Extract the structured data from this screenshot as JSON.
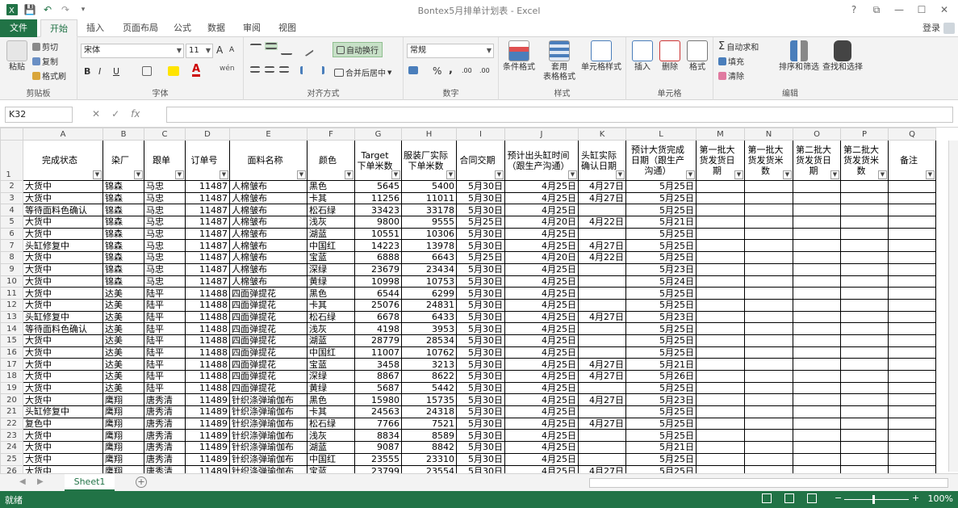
{
  "window": {
    "title": "Bontex5月排单计划表 - Excel"
  },
  "qat": {
    "save": "💾",
    "undo": "↶",
    "redo": "↷",
    "more": "▾"
  },
  "winctl": {
    "help": "?",
    "restore": "⧉",
    "min": "—",
    "max": "☐",
    "close": "✕"
  },
  "tabs": [
    "文件",
    "开始",
    "插入",
    "页面布局",
    "公式",
    "数据",
    "审阅",
    "视图"
  ],
  "active_tab": "开始",
  "account": {
    "login": "登录"
  },
  "ribbon": {
    "clipboard": {
      "paste": "粘贴",
      "cut": "剪切",
      "copy": "复制",
      "painter": "格式刷",
      "label": "剪贴板"
    },
    "font": {
      "name": "宋体",
      "size": "11",
      "bold": "B",
      "italic": "I",
      "underline": "U",
      "grow": "A",
      "shrink": "A",
      "label": "字体",
      "wen": "wén"
    },
    "align": {
      "wrap": "自动换行",
      "merge": "合并后居中",
      "label": "对齐方式"
    },
    "number": {
      "format": "常规",
      "percent": "%",
      "comma": ",",
      "inc": ".00",
      "label": "数字"
    },
    "styles": {
      "cond": "条件格式",
      "table": "套用\n表格格式",
      "cell": "单元格样式",
      "label": "样式"
    },
    "cells": {
      "insert": "插入",
      "delete": "删除",
      "format": "格式",
      "label": "单元格"
    },
    "editing": {
      "autosum": "自动求和",
      "fill": "填充",
      "clear": "清除",
      "sort": "排序和筛选",
      "find": "查找和选择",
      "label": "编辑"
    }
  },
  "formula_bar": {
    "name_box": "K32",
    "cancel": "✕",
    "enter": "✓",
    "fx": "fx",
    "value": ""
  },
  "columns": [
    "A",
    "B",
    "C",
    "D",
    "E",
    "F",
    "G",
    "H",
    "I",
    "J",
    "K",
    "L",
    "M",
    "N",
    "O",
    "P",
    "Q"
  ],
  "headers": [
    "完成状态",
    "染厂",
    "跟单",
    "订单号",
    "面料名称",
    "颜色",
    "Target下单米数",
    "服装厂实际下单米数",
    "合同交期",
    "预计出头缸时间（跟生产沟通）",
    "头缸实际确认日期",
    "预计大货完成日期（跟生产沟通）",
    "第一批大货发货日期",
    "第一批大货发货米数",
    "第二批大货发货日期",
    "第二批大货发货米数",
    "备注"
  ],
  "rows": [
    [
      "大货中",
      "锦森",
      "马忠",
      "11487",
      "人棉皱布",
      "黑色",
      "5645",
      "5400",
      "5月30日",
      "4月25日",
      "4月27日",
      "5月25日"
    ],
    [
      "大货中",
      "锦森",
      "马忠",
      "11487",
      "人棉皱布",
      "卡其",
      "11256",
      "11011",
      "5月30日",
      "4月25日",
      "4月27日",
      "5月25日"
    ],
    [
      "等待面料色确认",
      "锦森",
      "马忠",
      "11487",
      "人棉皱布",
      "松石绿",
      "33423",
      "33178",
      "5月30日",
      "4月25日",
      "",
      "5月25日"
    ],
    [
      "大货中",
      "锦森",
      "马忠",
      "11487",
      "人棉皱布",
      "浅灰",
      "9800",
      "9555",
      "5月25日",
      "4月20日",
      "4月22日",
      "5月21日"
    ],
    [
      "大货中",
      "锦森",
      "马忠",
      "11487",
      "人棉皱布",
      "湖蓝",
      "10551",
      "10306",
      "5月30日",
      "4月25日",
      "",
      "5月25日"
    ],
    [
      "头缸修复中",
      "锦森",
      "马忠",
      "11487",
      "人棉皱布",
      "中国红",
      "14223",
      "13978",
      "5月30日",
      "4月25日",
      "4月27日",
      "5月25日"
    ],
    [
      "大货中",
      "锦森",
      "马忠",
      "11487",
      "人棉皱布",
      "宝蓝",
      "6888",
      "6643",
      "5月25日",
      "4月20日",
      "4月22日",
      "5月25日"
    ],
    [
      "大货中",
      "锦森",
      "马忠",
      "11487",
      "人棉皱布",
      "深绿",
      "23679",
      "23434",
      "5月30日",
      "4月25日",
      "",
      "5月23日"
    ],
    [
      "大货中",
      "锦森",
      "马忠",
      "11487",
      "人棉皱布",
      "黄绿",
      "10998",
      "10753",
      "5月30日",
      "4月25日",
      "",
      "5月24日"
    ],
    [
      "大货中",
      "达美",
      "陆平",
      "11488",
      "四面弹提花",
      "黑色",
      "6544",
      "6299",
      "5月30日",
      "4月25日",
      "",
      "5月25日"
    ],
    [
      "大货中",
      "达美",
      "陆平",
      "11488",
      "四面弹提花",
      "卡其",
      "25076",
      "24831",
      "5月30日",
      "4月25日",
      "",
      "5月25日"
    ],
    [
      "头缸修复中",
      "达美",
      "陆平",
      "11488",
      "四面弹提花",
      "松石绿",
      "6678",
      "6433",
      "5月30日",
      "4月25日",
      "4月27日",
      "5月23日"
    ],
    [
      "等待面料色确认",
      "达美",
      "陆平",
      "11488",
      "四面弹提花",
      "浅灰",
      "4198",
      "3953",
      "5月30日",
      "4月25日",
      "",
      "5月25日"
    ],
    [
      "大货中",
      "达美",
      "陆平",
      "11488",
      "四面弹提花",
      "湖蓝",
      "28779",
      "28534",
      "5月30日",
      "4月25日",
      "",
      "5月25日"
    ],
    [
      "大货中",
      "达美",
      "陆平",
      "11488",
      "四面弹提花",
      "中国红",
      "11007",
      "10762",
      "5月30日",
      "4月25日",
      "",
      "5月25日"
    ],
    [
      "大货中",
      "达美",
      "陆平",
      "11488",
      "四面弹提花",
      "宝蓝",
      "3458",
      "3213",
      "5月30日",
      "4月25日",
      "4月27日",
      "5月21日"
    ],
    [
      "大货中",
      "达美",
      "陆平",
      "11488",
      "四面弹提花",
      "深绿",
      "8867",
      "8622",
      "5月30日",
      "4月25日",
      "4月27日",
      "5月26日"
    ],
    [
      "大货中",
      "达美",
      "陆平",
      "11488",
      "四面弹提花",
      "黄绿",
      "5687",
      "5442",
      "5月30日",
      "4月25日",
      "",
      "5月25日"
    ],
    [
      "大货中",
      "鹰翔",
      "唐秀清",
      "11489",
      "针织涤弹瑜伽布",
      "黑色",
      "15980",
      "15735",
      "5月30日",
      "4月25日",
      "4月27日",
      "5月23日"
    ],
    [
      "头缸修复中",
      "鹰翔",
      "唐秀清",
      "11489",
      "针织涤弹瑜伽布",
      "卡其",
      "24563",
      "24318",
      "5月30日",
      "4月25日",
      "",
      "5月25日"
    ],
    [
      "复色中",
      "鹰翔",
      "唐秀清",
      "11489",
      "针织涤弹瑜伽布",
      "松石绿",
      "7766",
      "7521",
      "5月30日",
      "4月25日",
      "4月27日",
      "5月25日"
    ],
    [
      "大货中",
      "鹰翔",
      "唐秀清",
      "11489",
      "针织涤弹瑜伽布",
      "浅灰",
      "8834",
      "8589",
      "5月30日",
      "4月25日",
      "",
      "5月25日"
    ],
    [
      "大货中",
      "鹰翔",
      "唐秀清",
      "11489",
      "针织涤弹瑜伽布",
      "湖蓝",
      "9087",
      "8842",
      "5月30日",
      "4月25日",
      "",
      "5月21日"
    ],
    [
      "大货中",
      "鹰翔",
      "唐秀清",
      "11489",
      "针织涤弹瑜伽布",
      "中国红",
      "23555",
      "23310",
      "5月30日",
      "4月25日",
      "",
      "5月25日"
    ],
    [
      "大货中",
      "鹰翔",
      "唐秀清",
      "11489",
      "针织涤弹瑜伽布",
      "宝蓝",
      "23799",
      "23554",
      "5月30日",
      "4月25日",
      "4月27日",
      "5月25日"
    ]
  ],
  "sheets": [
    "Sheet1"
  ],
  "status": {
    "ready": "就绪",
    "zoom": "100%",
    "minus": "−",
    "plus": "+"
  }
}
